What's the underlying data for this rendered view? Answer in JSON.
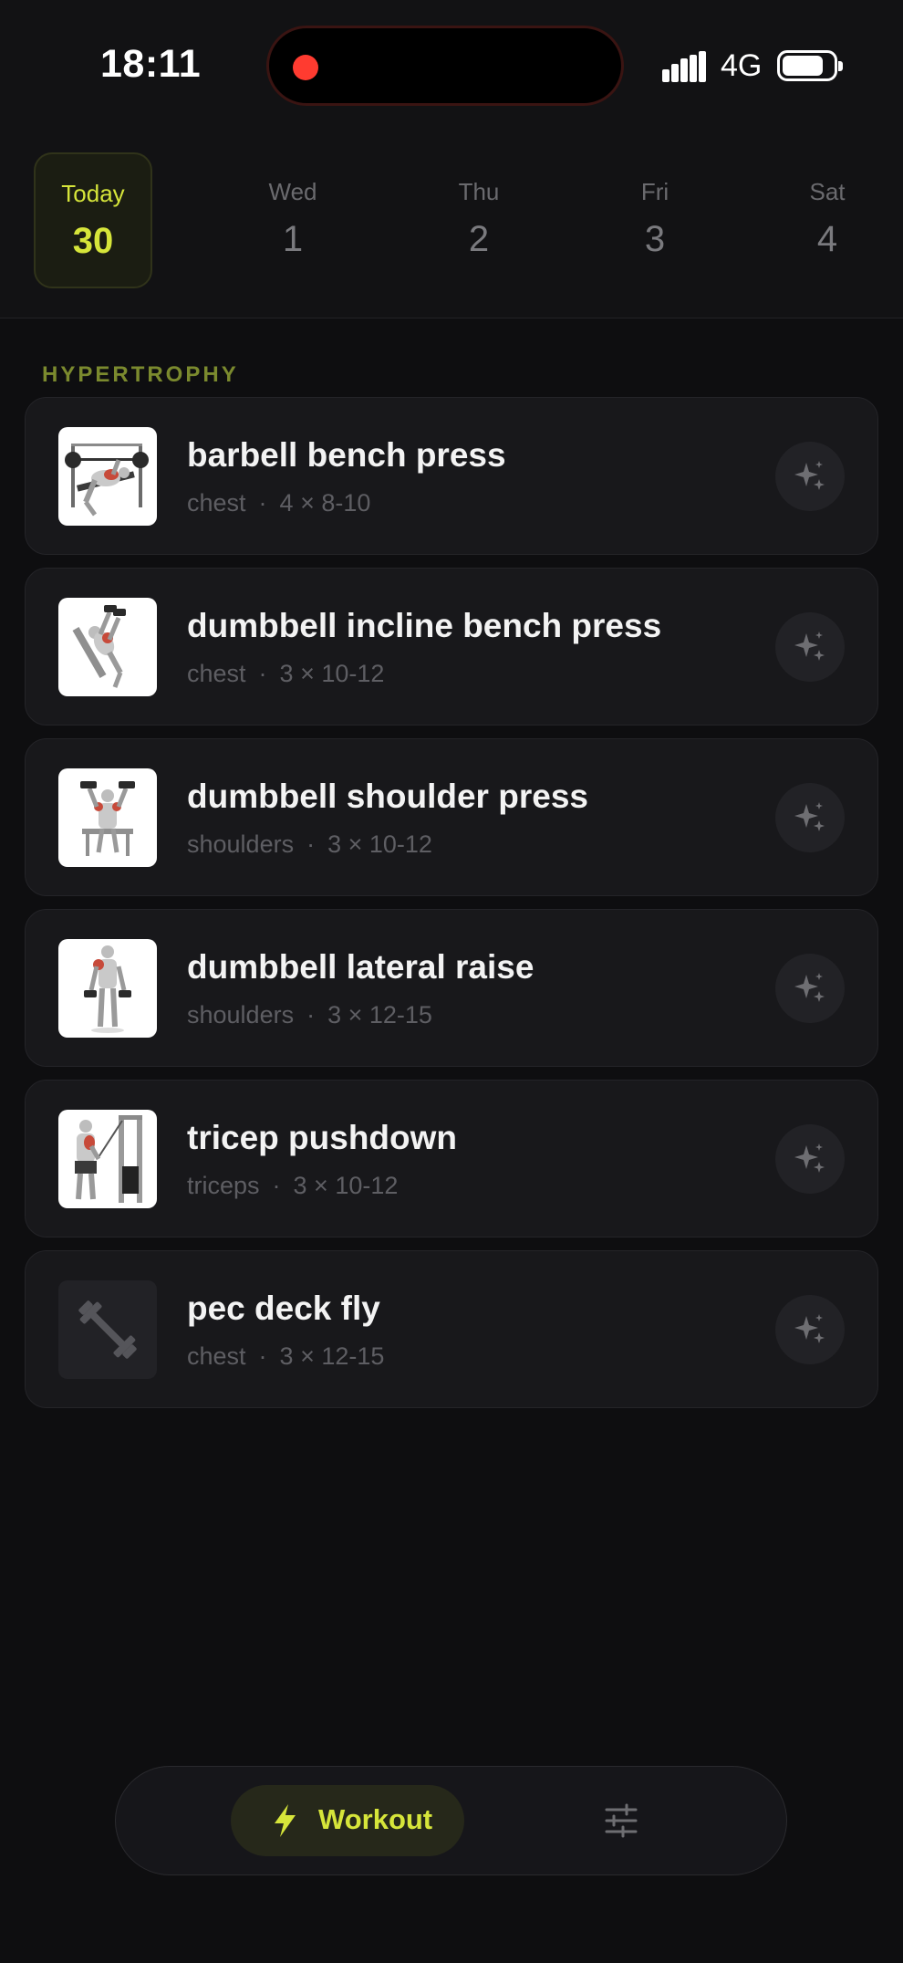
{
  "status_bar": {
    "time": "18:11",
    "network": "4G",
    "recording_indicator_color": "#ff3b30"
  },
  "week": [
    {
      "name": "Today",
      "num": "30",
      "selected": true
    },
    {
      "name": "Wed",
      "num": "1"
    },
    {
      "name": "Thu",
      "num": "2"
    },
    {
      "name": "Fri",
      "num": "3"
    },
    {
      "name": "Sat",
      "num": "4"
    }
  ],
  "section": {
    "label": "HYPERTROPHY"
  },
  "exercises": [
    {
      "name": "barbell bench press",
      "muscle": "chest",
      "sets": "4 × 8-10",
      "thumb": "bench-press-illustration"
    },
    {
      "name": "dumbbell incline bench press",
      "muscle": "chest",
      "sets": "3 × 10-12",
      "thumb": "incline-press-illustration"
    },
    {
      "name": "dumbbell shoulder press",
      "muscle": "shoulders",
      "sets": "3 × 10-12",
      "thumb": "shoulder-press-illustration"
    },
    {
      "name": "dumbbell lateral raise",
      "muscle": "shoulders",
      "sets": "3 × 12-15",
      "thumb": "lateral-raise-illustration"
    },
    {
      "name": "tricep pushdown",
      "muscle": "triceps",
      "sets": "3 × 10-12",
      "thumb": "pushdown-illustration"
    },
    {
      "name": "pec deck fly",
      "muscle": "chest",
      "sets": "3 × 12-15",
      "thumb": "dumbbell-placeholder-icon"
    }
  ],
  "meta_separator": "·",
  "nav": {
    "workout_label": "Workout",
    "workout_icon": "lightning-bolt-icon",
    "settings_icon": "sliders-icon"
  },
  "colors": {
    "accent": "#d6e53a",
    "background": "#0e0e10",
    "card": "#18181b",
    "section_label": "#7b8a2e"
  }
}
